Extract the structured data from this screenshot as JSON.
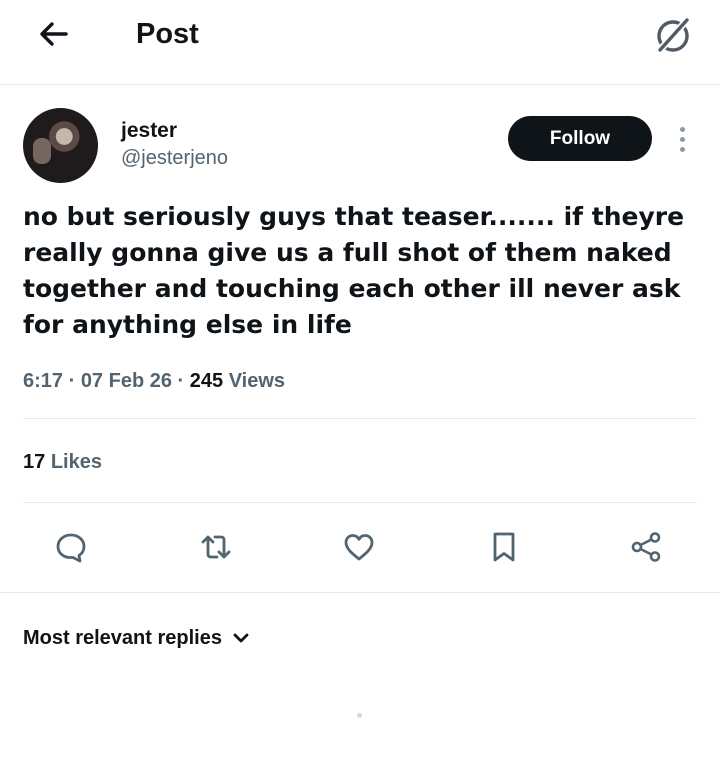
{
  "header": {
    "title": "Post",
    "back_icon": "arrow-left-icon",
    "right_icon": "grok-icon"
  },
  "post": {
    "author": {
      "display_name": "jester",
      "handle": "@jesterjeno",
      "avatar_icon": "user-avatar"
    },
    "follow_label": "Follow",
    "text": "no but seriously guys that teaser....... if theyre really gonna give us a full shot of them naked together and touching each other ill never ask for anything else in life",
    "time": "6:17",
    "date": "07 Feb 26",
    "views_count": "245",
    "views_label": "Views",
    "likes_count": "17",
    "likes_label": "Likes"
  },
  "actions": [
    {
      "name": "reply-icon"
    },
    {
      "name": "repost-icon"
    },
    {
      "name": "like-icon"
    },
    {
      "name": "bookmark-icon"
    },
    {
      "name": "share-icon"
    }
  ],
  "replies": {
    "sort_label": "Most relevant replies",
    "sort_icon": "chevron-down-icon"
  },
  "colors": {
    "text_primary": "#0f1419",
    "text_secondary": "#536471",
    "divider": "#e6e9ec",
    "follow_bg": "#0f1419"
  }
}
